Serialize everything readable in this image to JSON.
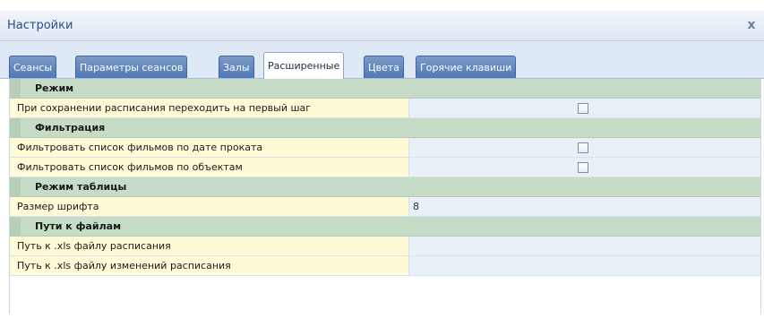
{
  "window": {
    "title": "Настройки",
    "close_label": "x"
  },
  "tabs": [
    {
      "label": "Сеансы"
    },
    {
      "label": "Параметры сеансов"
    },
    {
      "label": "Залы"
    },
    {
      "label": "Расширенные"
    },
    {
      "label": "Цвета"
    },
    {
      "label": "Горячие клавиши"
    }
  ],
  "active_tab": "Расширенные",
  "grid": {
    "sections": [
      {
        "title": "Режим",
        "rows": [
          {
            "name": "При сохранении расписания переходить на первый шаг",
            "type": "checkbox",
            "checked": false
          }
        ]
      },
      {
        "title": "Фильтрация",
        "rows": [
          {
            "name": "Фильтровать список фильмов по дате проката",
            "type": "checkbox",
            "checked": false
          },
          {
            "name": "Фильтровать список фильмов по объектам",
            "type": "checkbox",
            "checked": false
          }
        ]
      },
      {
        "title": "Режим таблицы",
        "rows": [
          {
            "name": "Размер шрифта",
            "type": "text",
            "value": "8"
          }
        ]
      },
      {
        "title": "Пути к файлам",
        "rows": [
          {
            "name": "Путь к .xls файлу расписания",
            "type": "text",
            "value": ""
          },
          {
            "name": "Путь к .xls файлу изменений расписания",
            "type": "text",
            "value": ""
          }
        ]
      }
    ]
  }
}
